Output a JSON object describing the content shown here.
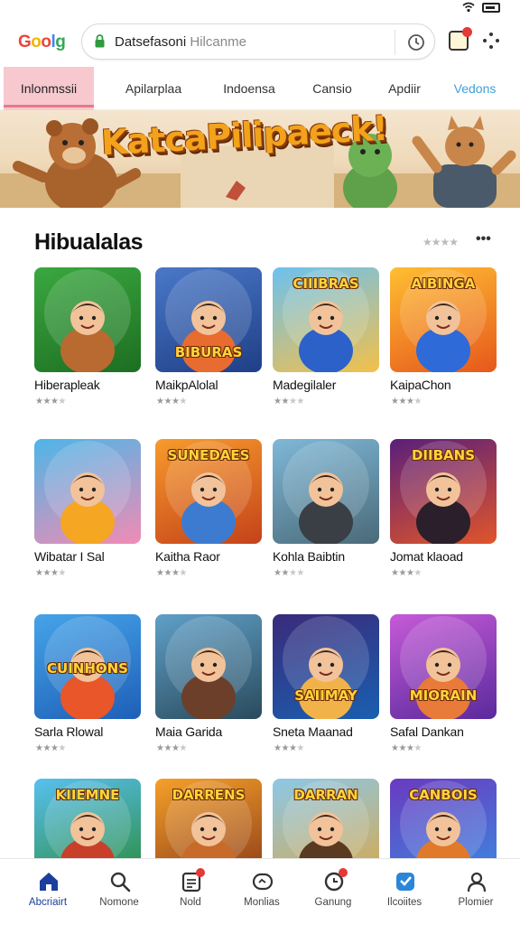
{
  "browser": {
    "logo": "Goolg",
    "url_main": "Datsefasoni",
    "url_muted": " Hilcanme"
  },
  "tabs": [
    {
      "label": "Inlonmssii",
      "style": "active"
    },
    {
      "label": "Apilarplaa",
      "style": ""
    },
    {
      "label": "Indoensa",
      "style": ""
    },
    {
      "label": "Cansio",
      "style": ""
    },
    {
      "label": "Apdiir",
      "style": ""
    },
    {
      "label": "Vedons",
      "style": "blue"
    }
  ],
  "banner": {
    "title": "KatcaPilipaeck!"
  },
  "section": {
    "title": "Hibualalas",
    "rating": "★★★★",
    "more": "•••"
  },
  "games": [
    {
      "title": "Hiberapleak",
      "thumb_text": "",
      "bg1": "#3aa83f",
      "bg2": "#1d6e22",
      "rating": 3,
      "char": "#b86a30"
    },
    {
      "title": "MaikpAlolal",
      "thumb_text": "BIBURAS",
      "bg1": "#4a78c8",
      "bg2": "#1f3f86",
      "rating": 3,
      "char": "#e86b2f"
    },
    {
      "title": "Madegilaler",
      "thumb_text": "CIIIBRAS",
      "bg1": "#6cc1ef",
      "bg2": "#f3c04a",
      "rating": 2,
      "char": "#2b61c9"
    },
    {
      "title": "KaipaChon",
      "thumb_text": "AIBINGA",
      "bg1": "#ffbe32",
      "bg2": "#e6581c",
      "rating": 3,
      "char": "#2e6ad8"
    },
    {
      "title": "Wibatar I Sal",
      "thumb_text": "",
      "bg1": "#4cb6e8",
      "bg2": "#f28bb4",
      "rating": 3,
      "char": "#f5a623"
    },
    {
      "title": "Kaitha Raor",
      "thumb_text": "SUNEDAES",
      "bg1": "#f79b2c",
      "bg2": "#c4421a",
      "rating": 3,
      "char": "#3d7bd0"
    },
    {
      "title": "Kohla Baibtin",
      "thumb_text": "",
      "bg1": "#7fb8d8",
      "bg2": "#4a6a78",
      "rating": 2,
      "char": "#3a3f46"
    },
    {
      "title": "Jomat klaoad",
      "thumb_text": "DIIBANS",
      "bg1": "#5a1f7a",
      "bg2": "#e0552a",
      "rating": 3,
      "char": "#2a1f2a"
    },
    {
      "title": "Sarla Rlowal",
      "thumb_text": "CUINHONS",
      "bg1": "#46a4e8",
      "bg2": "#1e5fb8",
      "rating": 3,
      "char": "#e8562a"
    },
    {
      "title": "Maia Garida",
      "thumb_text": "",
      "bg1": "#5fa0c8",
      "bg2": "#2a4a5c",
      "rating": 3,
      "char": "#6b3f2a"
    },
    {
      "title": "Sneta Maanad",
      "thumb_text": "SAIIMAY",
      "bg1": "#3a2a7a",
      "bg2": "#1a5fb0",
      "rating": 3,
      "char": "#f2b24a"
    },
    {
      "title": "Safal Dankan",
      "thumb_text": "MIORAIN",
      "bg1": "#c65ad8",
      "bg2": "#5a2a9c",
      "rating": 3,
      "char": "#e87a3a"
    },
    {
      "title": "",
      "thumb_text": "KIIEMNE",
      "bg1": "#58c0f0",
      "bg2": "#2a8a3a",
      "rating": 0,
      "char": "#c8402a"
    },
    {
      "title": "",
      "thumb_text": "DARRENS",
      "bg1": "#f5a02a",
      "bg2": "#8a3a18",
      "rating": 0,
      "char": "#c86a2a"
    },
    {
      "title": "",
      "thumb_text": "DARRAN",
      "bg1": "#8cc8e8",
      "bg2": "#d8a84a",
      "rating": 0,
      "char": "#5a3a20"
    },
    {
      "title": "",
      "thumb_text": "CANBOIS",
      "bg1": "#6a3ac0",
      "bg2": "#3a8ae0",
      "rating": 0,
      "char": "#e07a2a"
    }
  ],
  "bottom_nav": [
    {
      "label": "Abcriairt",
      "icon": "home-icon",
      "active": true
    },
    {
      "label": "Nomone",
      "icon": "search-icon",
      "active": false
    },
    {
      "label": "Nold",
      "icon": "library-icon",
      "active": false,
      "badge": true
    },
    {
      "label": "Monlias",
      "icon": "chat-icon",
      "active": false
    },
    {
      "label": "Ganung",
      "icon": "games-icon",
      "active": false,
      "badge": true
    },
    {
      "label": "Ilcoiites",
      "icon": "apps-icon",
      "active": false
    },
    {
      "label": "Plomier",
      "icon": "profile-icon",
      "active": false
    }
  ],
  "colors": {
    "accent": "#1a3f9c",
    "active_tab_bg": "#f7c9cf",
    "tab_blue": "#3fa0d8"
  }
}
